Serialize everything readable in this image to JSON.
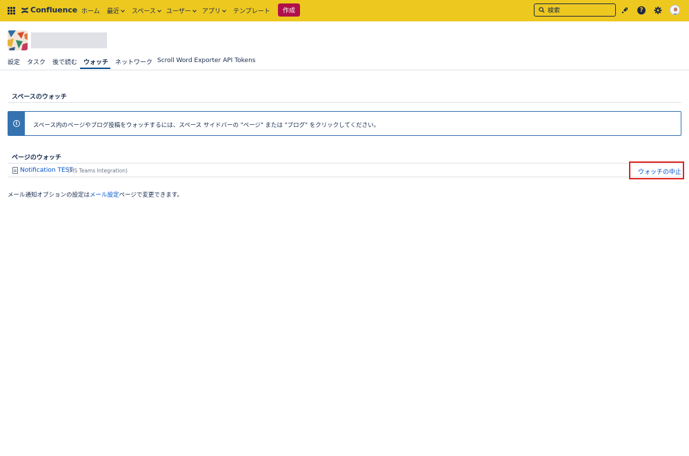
{
  "topnav": {
    "logo_text": "Confluence",
    "items": [
      {
        "label": "ホーム",
        "has_dropdown": false
      },
      {
        "label": "最近",
        "has_dropdown": true
      },
      {
        "label": "スペース",
        "has_dropdown": true
      },
      {
        "label": "ユーザー",
        "has_dropdown": true
      },
      {
        "label": "アプリ",
        "has_dropdown": true
      },
      {
        "label": "テンプレート",
        "has_dropdown": false
      }
    ],
    "create_label": "作成",
    "search_placeholder": "検索",
    "icons": [
      "app-switcher-icon",
      "confluence-logo-icon",
      "search-icon",
      "notification-icon",
      "help-icon",
      "settings-icon",
      "avatar"
    ]
  },
  "tabs": [
    {
      "label": "設定",
      "active": false
    },
    {
      "label": "タスク",
      "active": false
    },
    {
      "label": "後で読む",
      "active": false
    },
    {
      "label": "ウォッチ",
      "active": true
    },
    {
      "label": "ネットワーク",
      "active": false
    },
    {
      "label": "Scroll Word Exporter API Tokens",
      "active": false
    }
  ],
  "space_watches": {
    "title": "スペースのウォッチ",
    "info_text": "スペース内のページやブログ投稿をウォッチするには、スペース サイドバーの \"ページ\" または \"ブログ\" をクリックしてください。"
  },
  "page_watches": {
    "title": "ページのウォッチ",
    "rows": [
      {
        "page": "Notification TEST",
        "space": "(MS Teams Integration)",
        "action": "ウォッチの中止"
      }
    ]
  },
  "footer": {
    "prefix": "メール通知オプションの設定は",
    "link": "メール設定",
    "suffix": "ページで変更できます。"
  },
  "colors": {
    "topbar": "#edc81f",
    "create_button": "#b0104a",
    "link": "#0052cc",
    "info_border": "#3572b0",
    "highlight": "#e0251f"
  }
}
